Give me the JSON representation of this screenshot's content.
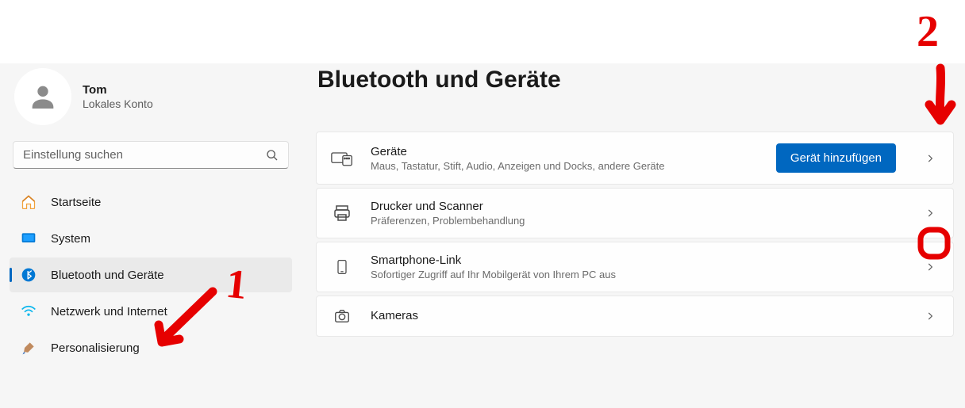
{
  "profile": {
    "name": "Tom",
    "sub": "Lokales Konto"
  },
  "search": {
    "placeholder": "Einstellung suchen"
  },
  "nav": {
    "items": [
      {
        "label": "Startseite"
      },
      {
        "label": "System"
      },
      {
        "label": "Bluetooth und Geräte"
      },
      {
        "label": "Netzwerk und Internet"
      },
      {
        "label": "Personalisierung"
      }
    ],
    "active_index": 2
  },
  "page": {
    "title": "Bluetooth und Geräte"
  },
  "cards": [
    {
      "title": "Geräte",
      "sub": "Maus, Tastatur, Stift, Audio, Anzeigen und Docks, andere Geräte",
      "action": "Gerät hinzufügen"
    },
    {
      "title": "Drucker und Scanner",
      "sub": "Präferenzen, Problembehandlung"
    },
    {
      "title": "Smartphone-Link",
      "sub": "Sofortiger Zugriff auf Ihr Mobilgerät von Ihrem PC aus"
    },
    {
      "title": "Kameras",
      "sub": ""
    }
  ],
  "annotations": {
    "one": "1",
    "two": "2"
  }
}
